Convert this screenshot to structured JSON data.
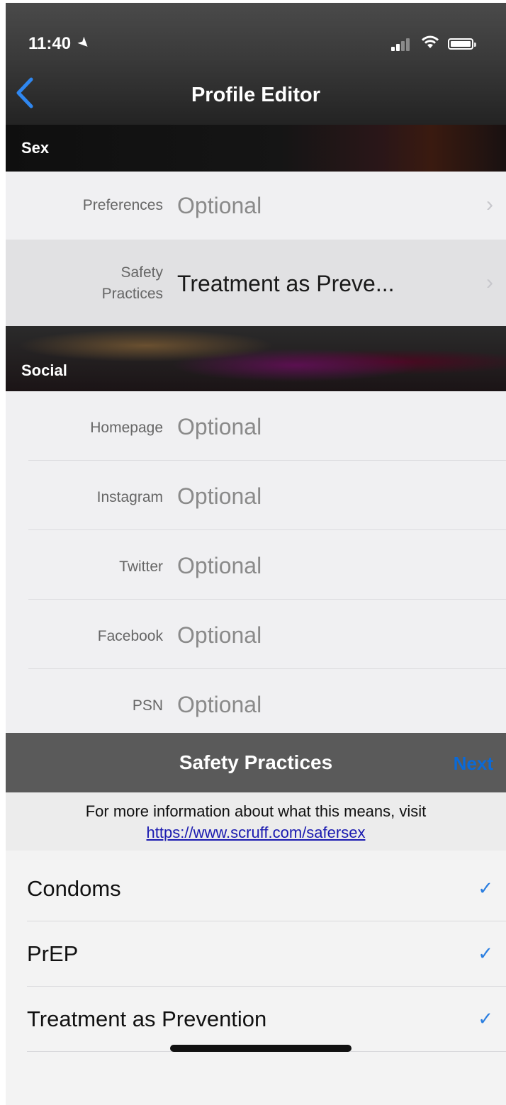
{
  "status_bar": {
    "time": "11:40"
  },
  "nav": {
    "title": "Profile Editor"
  },
  "sections": {
    "sex": "Sex",
    "social": "Social"
  },
  "sex_rows": {
    "preferences": {
      "label": "Preferences",
      "value": "Optional"
    },
    "safety": {
      "label_line1": "Safety",
      "label_line2": "Practices",
      "value": "Treatment as Preve..."
    }
  },
  "social_rows": {
    "homepage": {
      "label": "Homepage",
      "value": "Optional"
    },
    "instagram": {
      "label": "Instagram",
      "value": "Optional"
    },
    "twitter": {
      "label": "Twitter",
      "value": "Optional"
    },
    "facebook": {
      "label": "Facebook",
      "value": "Optional"
    },
    "psn": {
      "label": "PSN",
      "value": "Optional"
    }
  },
  "picker": {
    "title": "Safety Practices",
    "next_label": "Next",
    "info_text": "For more information about what this means, visit",
    "info_link": "https://www.scruff.com/safersex",
    "options": [
      {
        "label": "Condoms",
        "checked": true
      },
      {
        "label": "PrEP",
        "checked": true
      },
      {
        "label": "Treatment as Prevention",
        "checked": true
      }
    ]
  },
  "colors": {
    "accent": "#2a7ee0",
    "next": "#0a6ad8",
    "link": "#1a1ab0"
  }
}
